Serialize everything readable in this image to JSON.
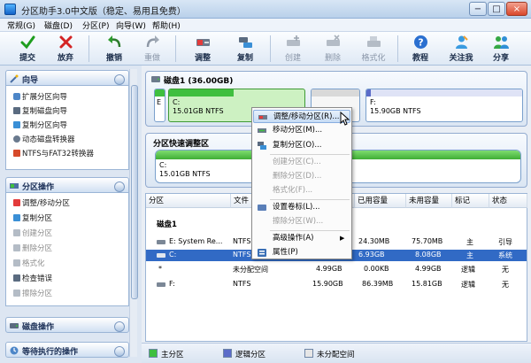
{
  "window": {
    "title": "分区助手3.0中文版（稳定、易用且免费）",
    "buttons": {
      "minimize": "−",
      "maximize": "□",
      "close": "×"
    }
  },
  "menu": [
    "常规(G)",
    "磁盘(D)",
    "分区(P)",
    "向导(W)",
    "帮助(H)"
  ],
  "toolbar": [
    {
      "label": "提交",
      "icon": "check-icon",
      "enabled": true
    },
    {
      "label": "放弃",
      "icon": "x-icon",
      "enabled": true
    },
    {
      "label": "撤销",
      "icon": "undo-icon",
      "enabled": true
    },
    {
      "label": "重做",
      "icon": "redo-icon",
      "enabled": false
    },
    {
      "label": "调整",
      "icon": "resize-partition-icon",
      "enabled": true
    },
    {
      "label": "复制",
      "icon": "copy-partition-icon",
      "enabled": true
    },
    {
      "label": "创建",
      "icon": "create-partition-icon",
      "enabled": false
    },
    {
      "label": "删除",
      "icon": "delete-partition-icon",
      "enabled": false
    },
    {
      "label": "格式化",
      "icon": "format-icon",
      "enabled": false
    },
    {
      "label": "教程",
      "icon": "help-icon",
      "enabled": true
    },
    {
      "label": "关注我",
      "icon": "follow-icon",
      "enabled": true
    },
    {
      "label": "分享",
      "icon": "share-icon",
      "enabled": true
    }
  ],
  "sidebar": {
    "wizard": {
      "title": "向导",
      "items": [
        {
          "label": "扩展分区向导",
          "enabled": true
        },
        {
          "label": "复制磁盘向导",
          "enabled": true
        },
        {
          "label": "复制分区向导",
          "enabled": true
        },
        {
          "label": "动态磁盘转换器",
          "enabled": true
        },
        {
          "label": "NTFS与FAT32转换器",
          "enabled": true
        }
      ]
    },
    "partition_ops": {
      "title": "分区操作",
      "items": [
        {
          "label": "调整/移动分区",
          "enabled": true
        },
        {
          "label": "复制分区",
          "enabled": true
        },
        {
          "label": "创建分区",
          "enabled": false
        },
        {
          "label": "删除分区",
          "enabled": false
        },
        {
          "label": "格式化",
          "enabled": false
        },
        {
          "label": "检查错误",
          "enabled": true
        },
        {
          "label": "擦除分区",
          "enabled": false
        }
      ]
    },
    "disk_ops": {
      "title": "磁盘操作"
    },
    "pending_ops": {
      "title": "等待执行的操作"
    }
  },
  "disk_map": {
    "disk_label": "磁盘1 (36.00GB)",
    "segments": [
      {
        "name": "E",
        "size": "",
        "color": "#3fbf3f"
      },
      {
        "name": "C:",
        "size": "15.01GB NTFS",
        "color": "#3fbf3f"
      },
      {
        "name": "",
        "size": "",
        "color": "#d9d9d9"
      },
      {
        "name": "F:",
        "size": "15.90GB NTFS",
        "color": "#5b6cc9"
      }
    ]
  },
  "resize_area": {
    "title": "分区快速调整区",
    "partition_name": "C:",
    "partition_size": "15.01GB NTFS"
  },
  "table": {
    "columns": [
      "分区",
      "文件",
      "",
      "已用容量",
      "未用容量",
      "标记",
      "状态"
    ],
    "disk_header": "磁盘1",
    "rows": [
      {
        "partition": "E: System Re...",
        "fs": "NTFS",
        "capacity": "",
        "used": "24.30MB",
        "unused": "75.70MB",
        "flag": "主",
        "status": "引导",
        "selected": false
      },
      {
        "partition": "C:",
        "fs": "NTFS",
        "capacity": "",
        "used": "6.93GB",
        "unused": "8.08GB",
        "flag": "主",
        "status": "系统",
        "selected": true
      },
      {
        "partition": "*",
        "fs": "未分配空间",
        "capacity": "4.99GB",
        "used": "0.00KB",
        "unused": "4.99GB",
        "flag": "逻辑",
        "status": "无",
        "selected": false
      },
      {
        "partition": "F:",
        "fs": "NTFS",
        "capacity": "15.90GB",
        "used": "86.39MB",
        "unused": "15.81GB",
        "flag": "逻辑",
        "status": "无",
        "selected": false
      }
    ]
  },
  "context_menu": [
    {
      "label": "调整/移动分区(R)...",
      "enabled": true,
      "highlighted": true,
      "icon": "resize-icon"
    },
    {
      "label": "移动分区(M)...",
      "enabled": true,
      "icon": "move-icon"
    },
    {
      "label": "复制分区(O)...",
      "enabled": true,
      "icon": "copy-icon"
    },
    {
      "separator": true
    },
    {
      "label": "创建分区(C)...",
      "enabled": false,
      "icon": "create-icon"
    },
    {
      "label": "删除分区(D)...",
      "enabled": false,
      "icon": "delete-icon"
    },
    {
      "label": "格式化(F)...",
      "enabled": false,
      "icon": "format-icon"
    },
    {
      "separator": true
    },
    {
      "label": "设置卷标(L)...",
      "enabled": true,
      "icon": "label-icon"
    },
    {
      "label": "擦除分区(W)...",
      "enabled": false,
      "icon": "wipe-icon"
    },
    {
      "separator": true
    },
    {
      "label": "高级操作(A)",
      "enabled": true,
      "submenu": true,
      "icon": "advanced-icon"
    },
    {
      "label": "属性(P)",
      "enabled": true,
      "icon": "properties-icon"
    }
  ],
  "legend": [
    {
      "label": "主分区",
      "color": "#3fbf3f"
    },
    {
      "label": "逻辑分区",
      "color": "#5b6cc9"
    },
    {
      "label": "未分配空间",
      "color": "#e6e6e6"
    }
  ],
  "colors": {
    "primary_partition": "#3fbf3f",
    "logical_partition": "#5b6cc9",
    "selection": "#316ac5"
  }
}
